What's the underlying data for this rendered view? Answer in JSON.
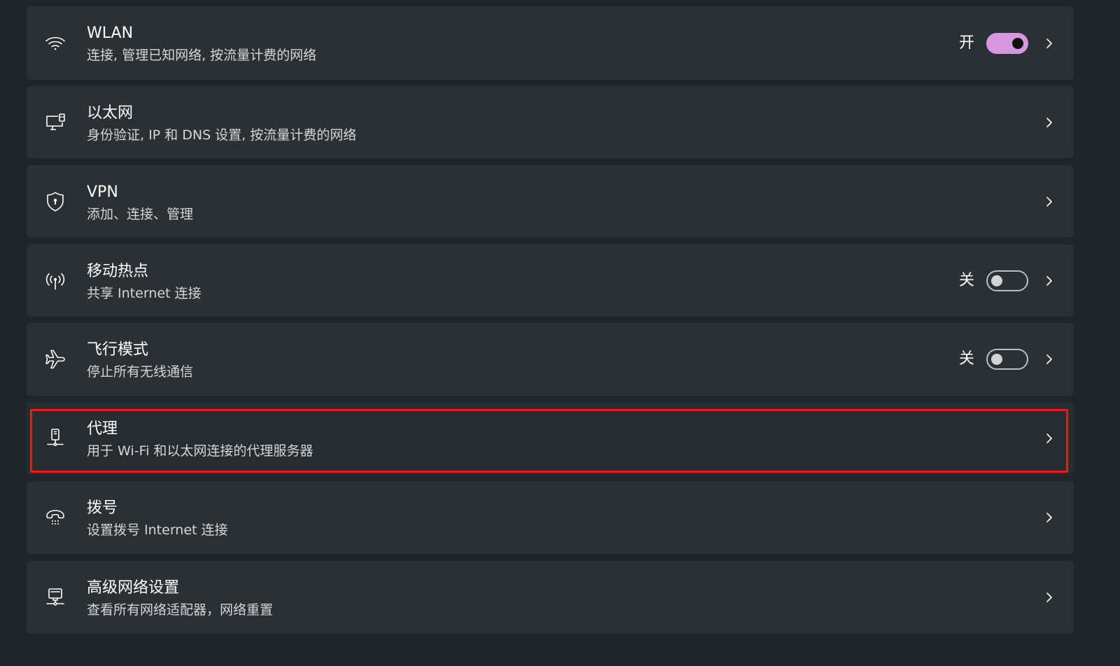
{
  "items": [
    {
      "title": "WLAN",
      "subtitle": "连接, 管理已知网络, 按流量计费的网络",
      "icon": "wifi-icon",
      "state_label": "开",
      "toggle": "on"
    },
    {
      "title": "以太网",
      "subtitle": "身份验证, IP 和 DNS 设置, 按流量计费的网络",
      "icon": "ethernet-icon"
    },
    {
      "title": "VPN",
      "subtitle": "添加、连接、管理",
      "icon": "shield-icon"
    },
    {
      "title": "移动热点",
      "subtitle": "共享 Internet 连接",
      "icon": "hotspot-icon",
      "state_label": "关",
      "toggle": "off"
    },
    {
      "title": "飞行模式",
      "subtitle": "停止所有无线通信",
      "icon": "airplane-icon",
      "state_label": "关",
      "toggle": "off"
    },
    {
      "title": "代理",
      "subtitle": "用于 Wi-Fi 和以太网连接的代理服务器",
      "icon": "proxy-icon",
      "highlighted": true
    },
    {
      "title": "拨号",
      "subtitle": "设置拨号 Internet 连接",
      "icon": "dialup-icon"
    },
    {
      "title": "高级网络设置",
      "subtitle": "查看所有网络适配器，网络重置",
      "icon": "advanced-network-icon"
    }
  ],
  "colors": {
    "background": "#1f2529",
    "card": "#2a3033",
    "toggle_on": "#d597de",
    "highlight_border": "#e81b1b"
  }
}
